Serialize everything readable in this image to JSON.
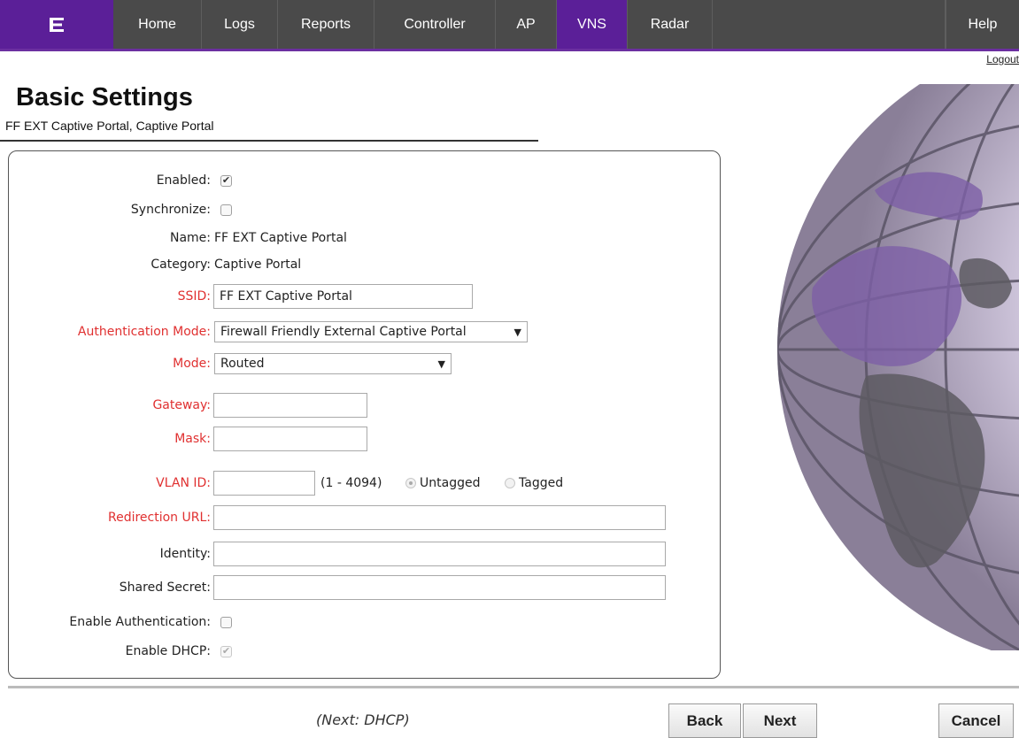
{
  "nav": {
    "items": [
      {
        "label": "Home"
      },
      {
        "label": "Logs"
      },
      {
        "label": "Reports"
      },
      {
        "label": "Controller"
      },
      {
        "label": "AP"
      },
      {
        "label": "VNS"
      },
      {
        "label": "Radar"
      }
    ],
    "help": "Help",
    "logout": "Logout",
    "active": "VNS",
    "accent_color": "#5b1f98"
  },
  "page": {
    "title": "Basic Settings",
    "subtitle": "FF EXT Captive Portal, Captive Portal"
  },
  "form": {
    "enabled": {
      "label": "Enabled:",
      "checked": true
    },
    "synchronize": {
      "label": "Synchronize:",
      "checked": false
    },
    "name": {
      "label": "Name:",
      "value": "FF EXT Captive Portal"
    },
    "category": {
      "label": "Category:",
      "value": "Captive Portal"
    },
    "ssid": {
      "label": "SSID:",
      "value": "FF EXT Captive Portal"
    },
    "auth_mode": {
      "label": "Authentication Mode:",
      "value": "Firewall Friendly External Captive Portal"
    },
    "mode": {
      "label": "Mode:",
      "value": "Routed"
    },
    "gateway": {
      "label": "Gateway:",
      "value": ""
    },
    "mask": {
      "label": "Mask:",
      "value": ""
    },
    "vlan": {
      "label": "VLAN ID:",
      "value": "",
      "range": "(1 - 4094)",
      "untagged": "Untagged",
      "tagged": "Tagged",
      "selected": "Untagged"
    },
    "redirection_url": {
      "label": "Redirection URL:",
      "value": ""
    },
    "identity": {
      "label": "Identity:",
      "value": ""
    },
    "shared_secret": {
      "label": "Shared Secret:",
      "value": ""
    },
    "enable_auth": {
      "label": "Enable Authentication:",
      "checked": false
    },
    "enable_dhcp": {
      "label": "Enable DHCP:",
      "checked": true,
      "disabled": true
    }
  },
  "footer": {
    "next_hint": "(Next: DHCP)",
    "back": "Back",
    "next": "Next",
    "cancel": "Cancel"
  },
  "colors": {
    "required_label": "#e03030",
    "nav_bg": "#4a4a4a"
  }
}
